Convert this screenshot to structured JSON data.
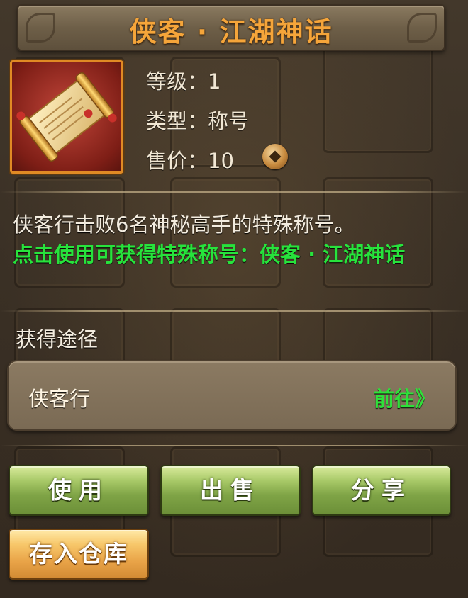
{
  "title": "侠客 · 江湖神话",
  "item": {
    "icon": "scroll-icon",
    "level_label": "等级：",
    "level_value": "1",
    "type_label": "类型：",
    "type_value": "称号",
    "price_label": "售价：",
    "price_value": "10",
    "currency_icon": "coin-icon"
  },
  "description": "侠客行击败6名神秘高手的特殊称号。",
  "usage_hint": "点击使用可获得特殊称号：侠客 · 江湖神话",
  "sources": {
    "title": "获得途径",
    "items": [
      {
        "name": "侠客行",
        "action": "前往》"
      }
    ]
  },
  "buttons": {
    "use": "使用",
    "sell": "出售",
    "share": "分享",
    "store": "存入仓库"
  },
  "colors": {
    "title": "#f5a53a",
    "green_text": "#27e33c",
    "frame": "#e08a24"
  }
}
